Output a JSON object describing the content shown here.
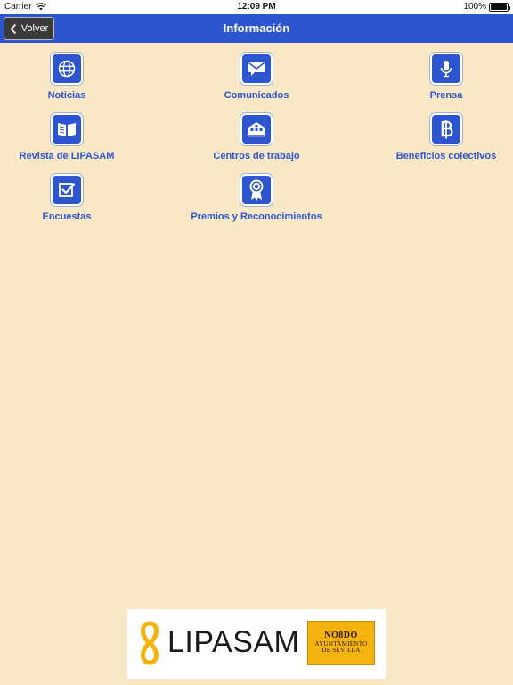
{
  "status_bar": {
    "carrier": "Carrier",
    "time": "12:09 PM",
    "battery": "100%"
  },
  "nav": {
    "back_label": "Volver",
    "title": "Información"
  },
  "menu": {
    "items": [
      {
        "label": "Noticias",
        "icon": "globe-icon"
      },
      {
        "label": "Comunicados",
        "icon": "envelope-icon"
      },
      {
        "label": "Prensa",
        "icon": "microphone-icon"
      },
      {
        "label": "Revista de LIPASAM",
        "icon": "open-book-icon"
      },
      {
        "label": "Centros de trabajo",
        "icon": "buildings-icon"
      },
      {
        "label": "Beneficios colectivos",
        "icon": "baht-icon"
      },
      {
        "label": "Encuestas",
        "icon": "checkbox-icon"
      },
      {
        "label": "Premios y Reconocimientos",
        "icon": "award-ribbon-icon"
      }
    ]
  },
  "footer": {
    "brand": "LIPASAM",
    "city_mark": "NO8DO",
    "city_line1": "AYUNTAMIENTO",
    "city_line2": "DE SEVILLA"
  },
  "colors": {
    "background": "#f8e8c6",
    "accent": "#2e55d0",
    "brand_yellow": "#f5b30f"
  }
}
